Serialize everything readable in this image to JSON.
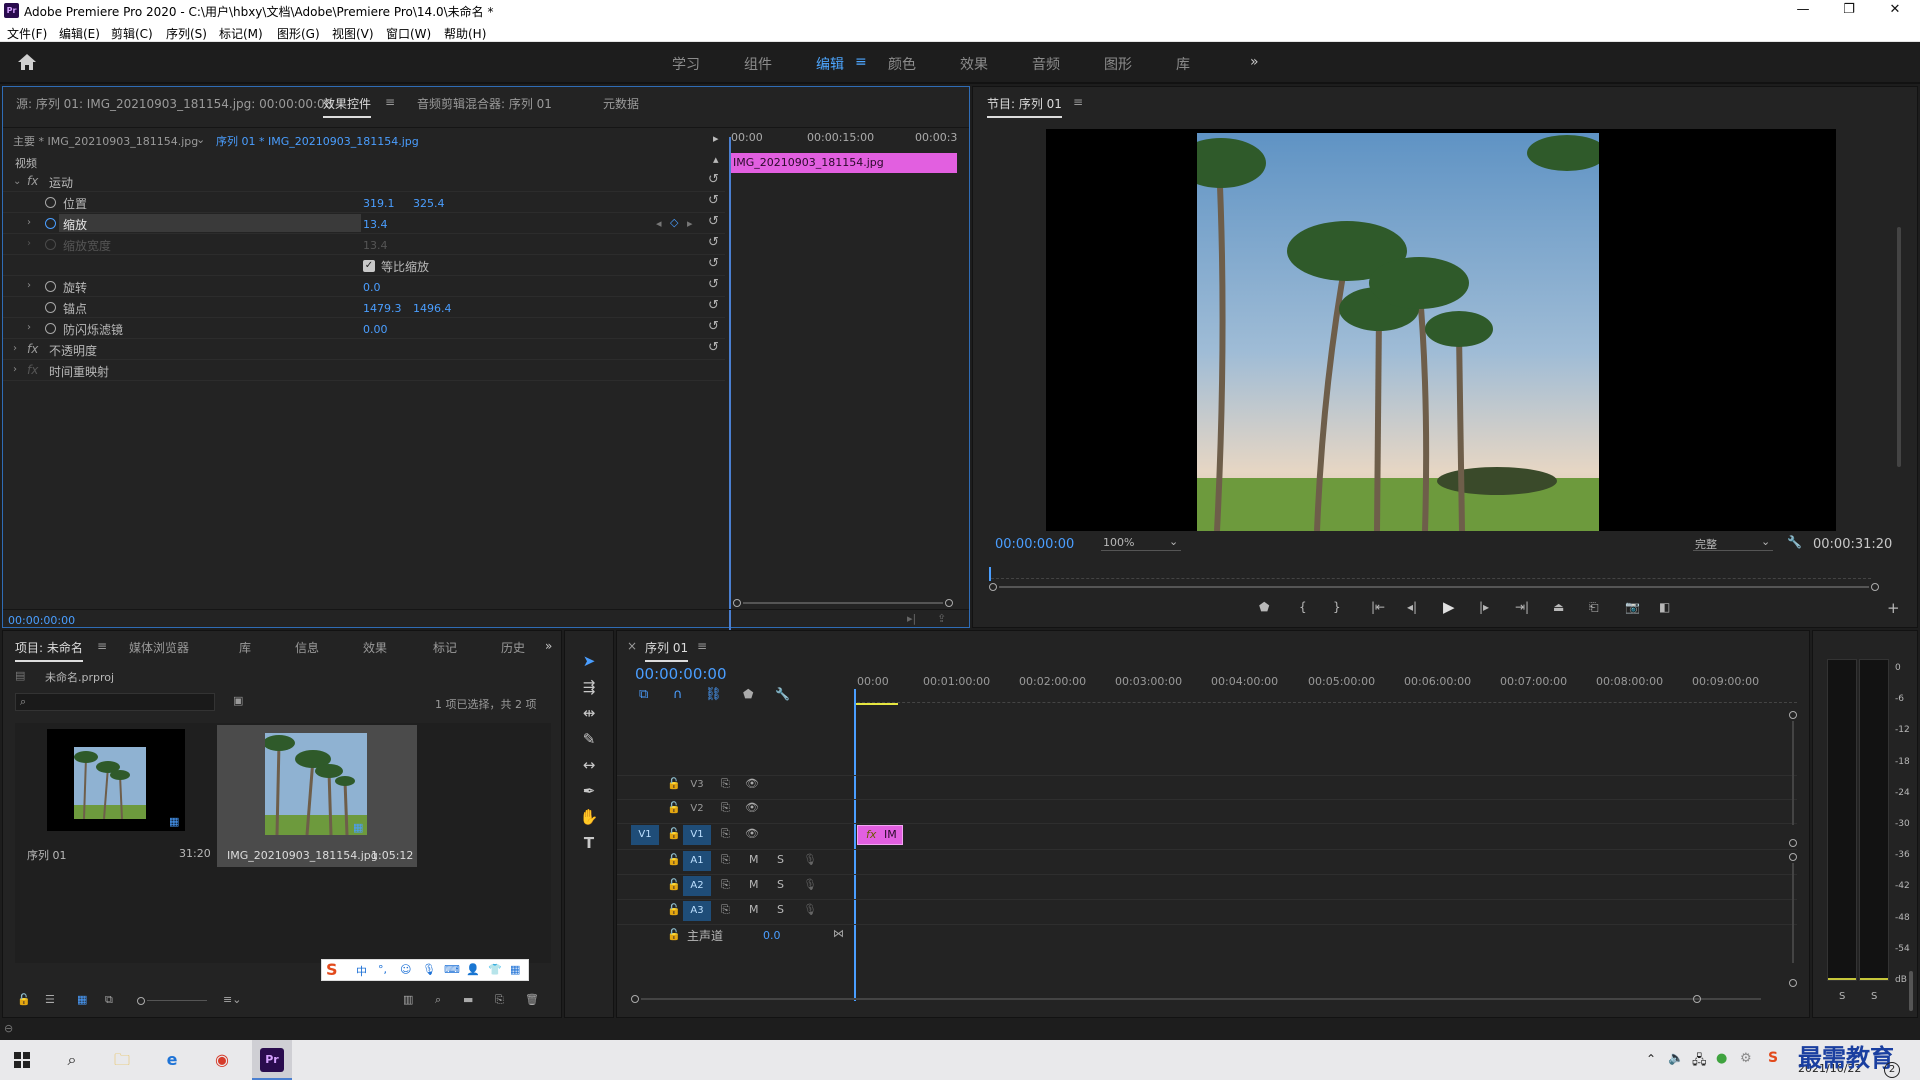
{
  "titlebar": {
    "title": "Adobe Premiere Pro 2020 - C:\\用户\\hbxy\\文档\\Adobe\\Premiere Pro\\14.0\\未命名 *",
    "logo": "Pr",
    "minimize": "—",
    "restore": "❐",
    "close": "✕"
  },
  "menu": [
    "文件(F)",
    "编辑(E)",
    "剪辑(C)",
    "序列(S)",
    "标记(M)",
    "图形(G)",
    "视图(V)",
    "窗口(W)",
    "帮助(H)"
  ],
  "workspaces": {
    "home_icon": "home-icon",
    "items": [
      "学习",
      "组件",
      "编辑",
      "颜色",
      "效果",
      "音频",
      "图形",
      "库"
    ],
    "active": "编辑",
    "menu_glyph": "≡",
    "more": "»"
  },
  "effect_controls": {
    "tabs": [
      "源: 序列 01: IMG_20210903_181154.jpg: 00:00:00:00",
      "效果控件",
      "音频剪辑混合器: 序列 01",
      "元数据"
    ],
    "tab_menu": "≡",
    "master_label": "主要 * IMG_20210903_181154.jpg",
    "sequence_label": "序列 01 * IMG_20210903_181154.jpg",
    "timeline_start": "00:00",
    "timeline_mid": "00:00:15:00",
    "timeline_end": "00:00:3",
    "clip_name": "IMG_20210903_181154.jpg",
    "video_header": "视频",
    "fx_label": "fx",
    "motion": "运动",
    "position_label": "位置",
    "position_x": "319.1",
    "position_y": "325.4",
    "scale_label": "缩放",
    "scale_value": "13.4",
    "scale_width_label": "缩放宽度",
    "scale_width_value": "13.4",
    "uniform_scale": "等比缩放",
    "rotation_label": "旋转",
    "rotation_value": "0.0",
    "anchor_label": "锚点",
    "anchor_x": "1479.3",
    "anchor_y": "1496.4",
    "antiflicker_label": "防闪烁滤镜",
    "antiflicker_value": "0.00",
    "opacity": "不透明度",
    "time_remap": "时间重映射",
    "timecode": "00:00:00:00"
  },
  "program_monitor": {
    "title": "节目: 序列 01",
    "tab_menu": "≡",
    "timecode": "00:00:00:00",
    "zoom": "100%",
    "quality": "完整",
    "duration": "00:00:31:20"
  },
  "project": {
    "tabs": [
      "项目: 未命名",
      "媒体浏览器",
      "库",
      "信息",
      "效果",
      "标记",
      "历史"
    ],
    "tab_menu": "≡",
    "more": "»",
    "file": "未命名.prproj",
    "selection_info": "1 项已选择，共 2 项",
    "items": [
      {
        "name": "序列 01",
        "duration": "31:20"
      },
      {
        "name": "IMG_20210903_181154.jpg",
        "duration": "1:05:12"
      }
    ],
    "ime_label": "中"
  },
  "timeline": {
    "close": "×",
    "title": "序列 01",
    "tab_menu": "≡",
    "timecode": "00:00:00:00",
    "ruler": [
      "00:00",
      "00:01:00:00",
      "00:02:00:00",
      "00:03:00:00",
      "00:04:00:00",
      "00:05:00:00",
      "00:06:00:00",
      "00:07:00:00",
      "00:08:00:00",
      "00:09:00:00"
    ],
    "tracks": [
      "V3",
      "V2",
      "V1",
      "A1",
      "A2",
      "A3"
    ],
    "source_patch": "V1",
    "mute": "M",
    "solo": "S",
    "master_label": "主声道",
    "master_value": "0.0",
    "clip_label": "IM",
    "clip_fx": "fx"
  },
  "audio_meter": {
    "scale": [
      "0",
      "-6",
      "-12",
      "-18",
      "-24",
      "-30",
      "-36",
      "-42",
      "-48",
      "-54",
      "dB"
    ],
    "solo": [
      "S",
      "S"
    ]
  },
  "taskbar": {
    "time": "",
    "date": "2021/10/22",
    "watermark": "最需教育",
    "notif_count": "2"
  }
}
